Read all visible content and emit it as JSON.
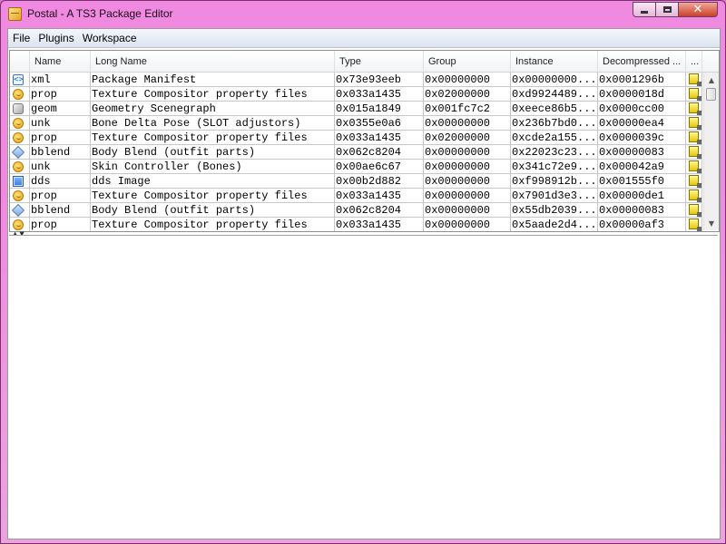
{
  "window": {
    "title": "Postal - A TS3 Package Editor"
  },
  "menu": [
    "File",
    "Plugins",
    "Workspace"
  ],
  "grid": {
    "columns": [
      "",
      "Name",
      "Long Name",
      "Type",
      "Group",
      "Instance",
      "Decompressed ...",
      "..."
    ],
    "rows": [
      {
        "icon": "xml",
        "name": "xml",
        "long": "Package Manifest",
        "type": "0x73e93eeb",
        "group": "0x00000000",
        "instance": "0x00000000...",
        "decomp": "0x0001296b"
      },
      {
        "icon": "prop",
        "name": "prop",
        "long": "Texture Compositor property files",
        "type": "0x033a1435",
        "group": "0x02000000",
        "instance": "0xd9924489...",
        "decomp": "0x0000018d"
      },
      {
        "icon": "geom",
        "name": "geom",
        "long": "Geometry Scenegraph",
        "type": "0x015a1849",
        "group": "0x001fc7c2",
        "instance": "0xeece86b5...",
        "decomp": "0x0000cc00"
      },
      {
        "icon": "prop",
        "name": "unk",
        "long": "Bone Delta Pose (SLOT adjustors)",
        "type": "0x0355e0a6",
        "group": "0x00000000",
        "instance": "0x236b7bd0...",
        "decomp": "0x00000ea4"
      },
      {
        "icon": "prop",
        "name": "prop",
        "long": "Texture Compositor property files",
        "type": "0x033a1435",
        "group": "0x02000000",
        "instance": "0xcde2a155...",
        "decomp": "0x0000039c"
      },
      {
        "icon": "bblend",
        "name": "bblend",
        "long": "Body Blend (outfit parts)",
        "type": "0x062c8204",
        "group": "0x00000000",
        "instance": "0x22023c23...",
        "decomp": "0x00000083"
      },
      {
        "icon": "prop",
        "name": "unk",
        "long": "Skin Controller (Bones)",
        "type": "0x00ae6c67",
        "group": "0x00000000",
        "instance": "0x341c72e9...",
        "decomp": "0x000042a9"
      },
      {
        "icon": "dds",
        "name": "dds",
        "long": "dds Image",
        "type": "0x00b2d882",
        "group": "0x00000000",
        "instance": "0xf998912b...",
        "decomp": "0x001555f0"
      },
      {
        "icon": "prop",
        "name": "prop",
        "long": "Texture Compositor property files",
        "type": "0x033a1435",
        "group": "0x00000000",
        "instance": "0x7901d3e3...",
        "decomp": "0x00000de1"
      },
      {
        "icon": "bblend",
        "name": "bblend",
        "long": "Body Blend (outfit parts)",
        "type": "0x062c8204",
        "group": "0x00000000",
        "instance": "0x55db2039...",
        "decomp": "0x00000083"
      },
      {
        "icon": "prop",
        "name": "prop",
        "long": "Texture Compositor property files",
        "type": "0x033a1435",
        "group": "0x00000000",
        "instance": "0x5aade2d4...",
        "decomp": "0x00000af3"
      }
    ]
  },
  "icons": {
    "xml": "xml-resource-icon",
    "prop": "property-resource-icon",
    "geom": "geometry-resource-icon",
    "bblend": "body-blend-resource-icon",
    "dds": "image-resource-icon",
    "extra": "notes-icon"
  },
  "colors": {
    "frame": "#ef8bde",
    "close_button": "#c9402b"
  }
}
